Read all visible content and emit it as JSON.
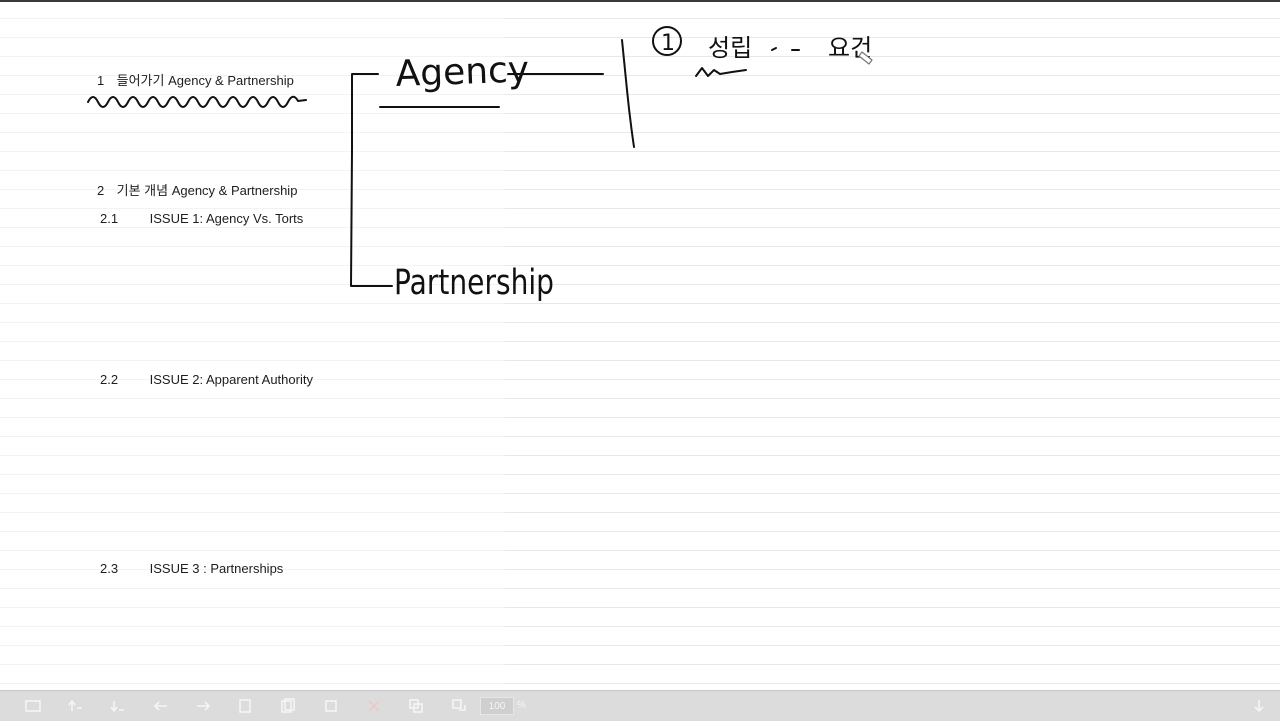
{
  "outline": {
    "section1": {
      "number": "1",
      "title": "들어가기 Agency & Partnership"
    },
    "section2": {
      "number": "2",
      "title": "기본 개념 Agency & Partnership"
    },
    "issue1": {
      "number": "2.1",
      "title": "ISSUE 1: Agency Vs. Torts"
    },
    "issue2": {
      "number": "2.2",
      "title": "ISSUE 2: Apparent Authority"
    },
    "issue3": {
      "number": "2.3",
      "title": "ISSUE 3 : Partnerships"
    }
  },
  "handwriting": {
    "agency": "Agency",
    "partnership": "Partnership",
    "circled_number": "1",
    "note_a": "성립",
    "note_b": "요건"
  },
  "toolbar": {
    "zoom_value": "100",
    "zoom_unit": "%",
    "icons": [
      "fit-page-icon",
      "move-up-icon",
      "move-down-icon",
      "undo-icon",
      "redo-icon",
      "page-icon",
      "page-double-icon",
      "select-icon",
      "delete-icon",
      "copy-icon",
      "paste-icon",
      "scroll-down-icon"
    ]
  }
}
